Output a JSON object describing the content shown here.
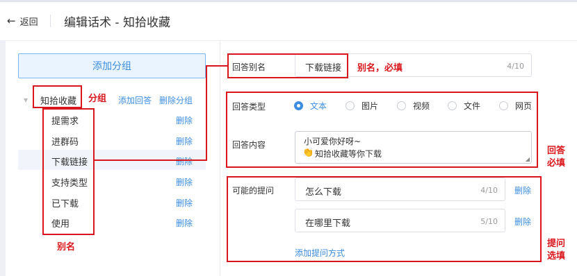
{
  "header": {
    "back_label": "返回",
    "title": "编辑话术 - 知拾收藏"
  },
  "sidebar": {
    "add_group_label": "添加分组",
    "group": {
      "name": "知拾收藏",
      "add_answer_label": "添加回答",
      "delete_group_label": "删除分组"
    },
    "items": [
      {
        "label": "提需求",
        "delete_label": "删除"
      },
      {
        "label": "进群码",
        "delete_label": "删除"
      },
      {
        "label": "下载链接",
        "delete_label": "删除"
      },
      {
        "label": "支持类型",
        "delete_label": "删除"
      },
      {
        "label": "已下载",
        "delete_label": "删除"
      },
      {
        "label": "使用",
        "delete_label": "删除"
      }
    ],
    "active_index": 2
  },
  "form": {
    "alias": {
      "label": "回答别名",
      "value": "下载链接",
      "count": "4/10"
    },
    "answer_type": {
      "label": "回答类型",
      "options": [
        "文本",
        "图片",
        "视频",
        "文件",
        "网页"
      ],
      "selected": "文本"
    },
    "answer_content": {
      "label": "回答内容",
      "line1": "小可爱你好呀~",
      "line2": "知拾收藏等你下载"
    },
    "questions": {
      "label": "可能的提问",
      "items": [
        {
          "value": "怎么下载",
          "count": "4/10",
          "delete_label": "删除"
        },
        {
          "value": "在哪里下载",
          "count": "5/10",
          "delete_label": "删除"
        }
      ],
      "add_label": "添加提问方式"
    }
  },
  "annotations": {
    "group": "分组",
    "alias_required": "别名，必填",
    "alias": "别名",
    "answer_required_1": "回答",
    "answer_required_2": "必填",
    "question_optional_1": "提问",
    "question_optional_2": "选填",
    "color": "#d9161b"
  },
  "colors": {
    "accent": "#3b8de0",
    "background": "#eef0f5"
  }
}
